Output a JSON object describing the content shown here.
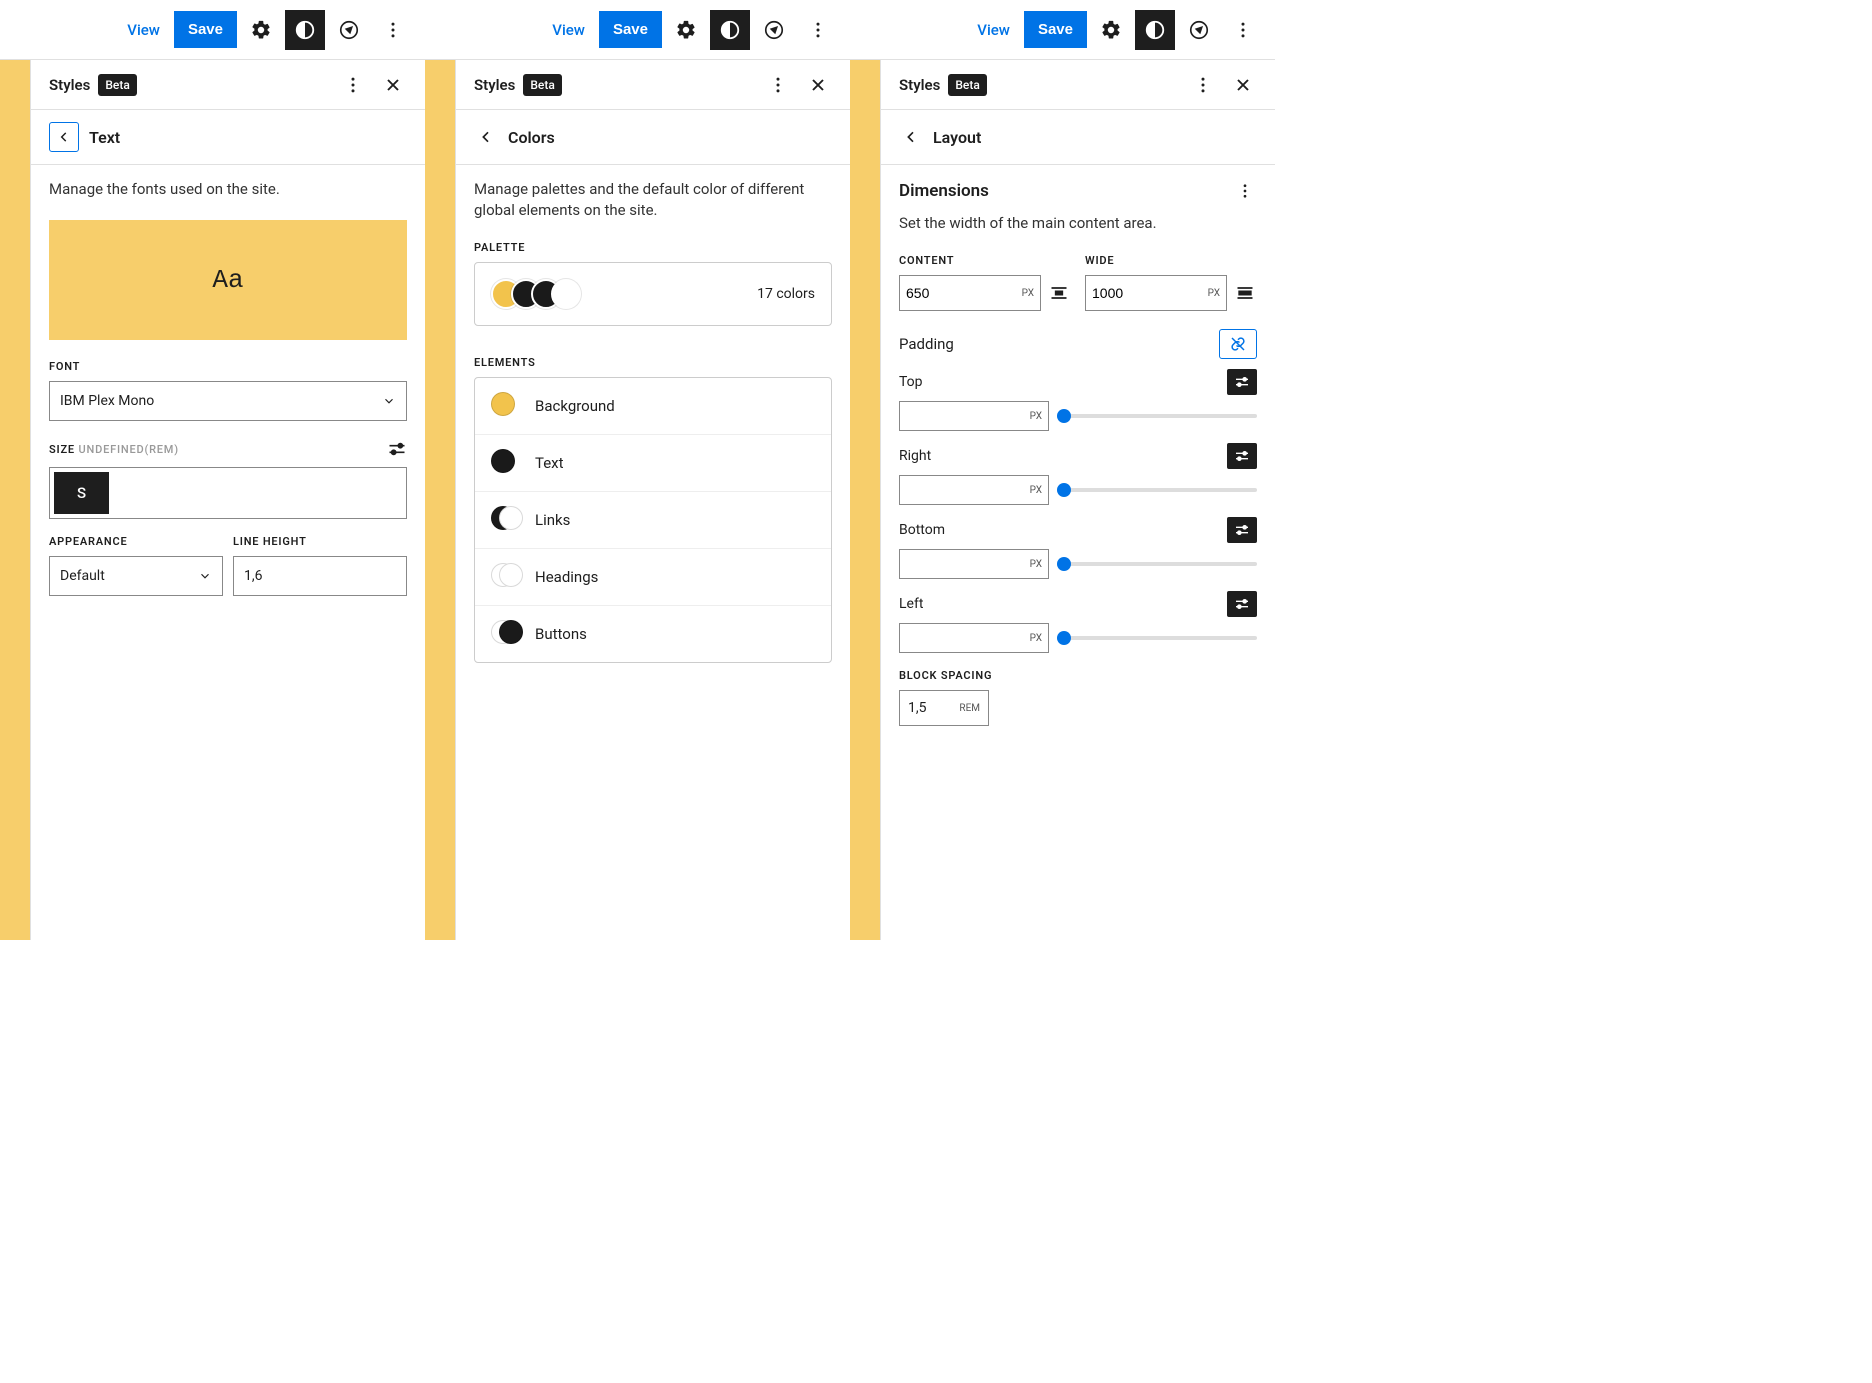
{
  "topbar": {
    "view": "View",
    "save": "Save"
  },
  "panelHead": {
    "title": "Styles",
    "badge": "Beta"
  },
  "text": {
    "nav": "Text",
    "desc": "Manage the fonts used on the site.",
    "preview": "Aa",
    "fontLabel": "FONT",
    "fontValue": "IBM Plex Mono",
    "sizeLabel": "SIZE",
    "sizeSub": "UNDEFINED(REM)",
    "sizeBtn": "S",
    "appearanceLabel": "APPEARANCE",
    "appearanceValue": "Default",
    "lineHeightLabel": "LINE HEIGHT",
    "lineHeightValue": "1,6"
  },
  "colors": {
    "nav": "Colors",
    "desc": "Manage palettes and the default color of different global elements on the site.",
    "paletteLabel": "PALETTE",
    "paletteCount": "17 colors",
    "elementsLabel": "ELEMENTS",
    "items": {
      "background": "Background",
      "text": "Text",
      "links": "Links",
      "headings": "Headings",
      "buttons": "Buttons"
    }
  },
  "layout": {
    "nav": "Layout",
    "dimTitle": "Dimensions",
    "dimDesc": "Set the width of the main content area.",
    "contentLabel": "CONTENT",
    "contentValue": "650",
    "wideLabel": "WIDE",
    "wideValue": "1000",
    "px": "PX",
    "paddingLabel": "Padding",
    "sides": {
      "top": "Top",
      "right": "Right",
      "bottom": "Bottom",
      "left": "Left"
    },
    "blockSpacingLabel": "BLOCK SPACING",
    "blockSpacingValue": "1,5",
    "rem": "REM"
  },
  "swatches": {
    "yellow": "#f2c34c",
    "black": "#1a1a1a",
    "white": "#ffffff"
  }
}
